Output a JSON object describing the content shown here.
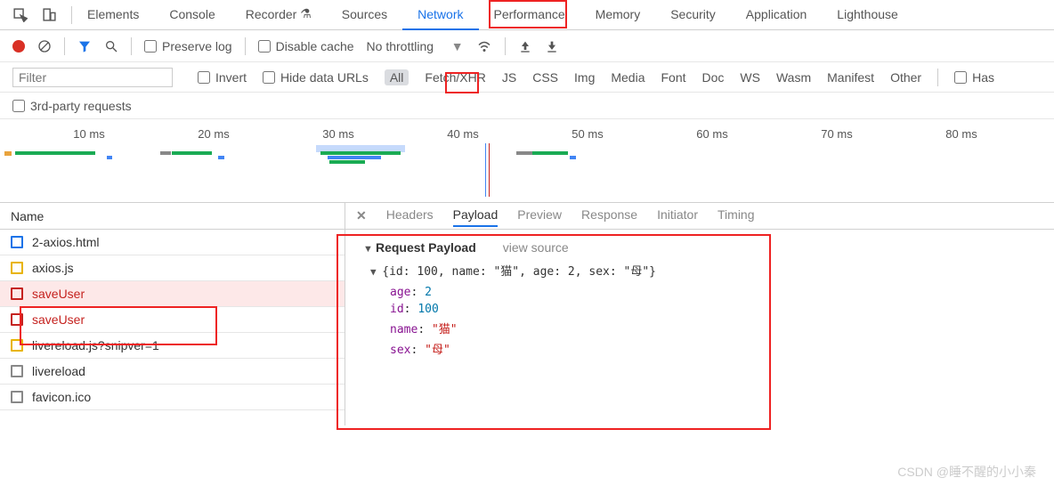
{
  "main_tabs": {
    "elements": "Elements",
    "console": "Console",
    "recorder": "Recorder",
    "sources": "Sources",
    "network": "Network",
    "performance": "Performance",
    "memory": "Memory",
    "security": "Security",
    "application": "Application",
    "lighthouse": "Lighthouse",
    "active": "Network"
  },
  "toolbar": {
    "preserve_log": "Preserve log",
    "disable_cache": "Disable cache",
    "throttling": "No throttling"
  },
  "filter_row": {
    "placeholder": "Filter",
    "invert": "Invert",
    "hide_data_urls": "Hide data URLs",
    "types": [
      "All",
      "Fetch/XHR",
      "JS",
      "CSS",
      "Img",
      "Media",
      "Font",
      "Doc",
      "WS",
      "Wasm",
      "Manifest",
      "Other"
    ],
    "active": "All",
    "has": "Has"
  },
  "third_party": "3rd-party requests",
  "timeline_ticks": [
    "10 ms",
    "20 ms",
    "30 ms",
    "40 ms",
    "50 ms",
    "60 ms",
    "70 ms",
    "80 ms"
  ],
  "name_header": "Name",
  "requests": [
    {
      "name": "2-axios.html",
      "type": "doc"
    },
    {
      "name": "axios.js",
      "type": "js"
    },
    {
      "name": "saveUser",
      "type": "xhr-err",
      "selected": true
    },
    {
      "name": "saveUser",
      "type": "xhr-err"
    },
    {
      "name": "livereload.js?snipver=1",
      "type": "js"
    },
    {
      "name": "livereload",
      "type": "other"
    },
    {
      "name": "favicon.ico",
      "type": "other"
    }
  ],
  "detail_tabs": {
    "headers": "Headers",
    "payload": "Payload",
    "preview": "Preview",
    "response": "Response",
    "initiator": "Initiator",
    "timing": "Timing",
    "active": "Payload"
  },
  "payload": {
    "title": "Request Payload",
    "view_source": "view source",
    "summary": "{id: 100, name: \"猫\", age: 2, sex: \"母\"}",
    "props": [
      {
        "k": "age",
        "v": "2",
        "t": "num"
      },
      {
        "k": "id",
        "v": "100",
        "t": "num"
      },
      {
        "k": "name",
        "v": "\"猫\"",
        "t": "str"
      },
      {
        "k": "sex",
        "v": "\"母\"",
        "t": "str"
      }
    ]
  },
  "watermark": "CSDN @睡不醒的小小秦"
}
